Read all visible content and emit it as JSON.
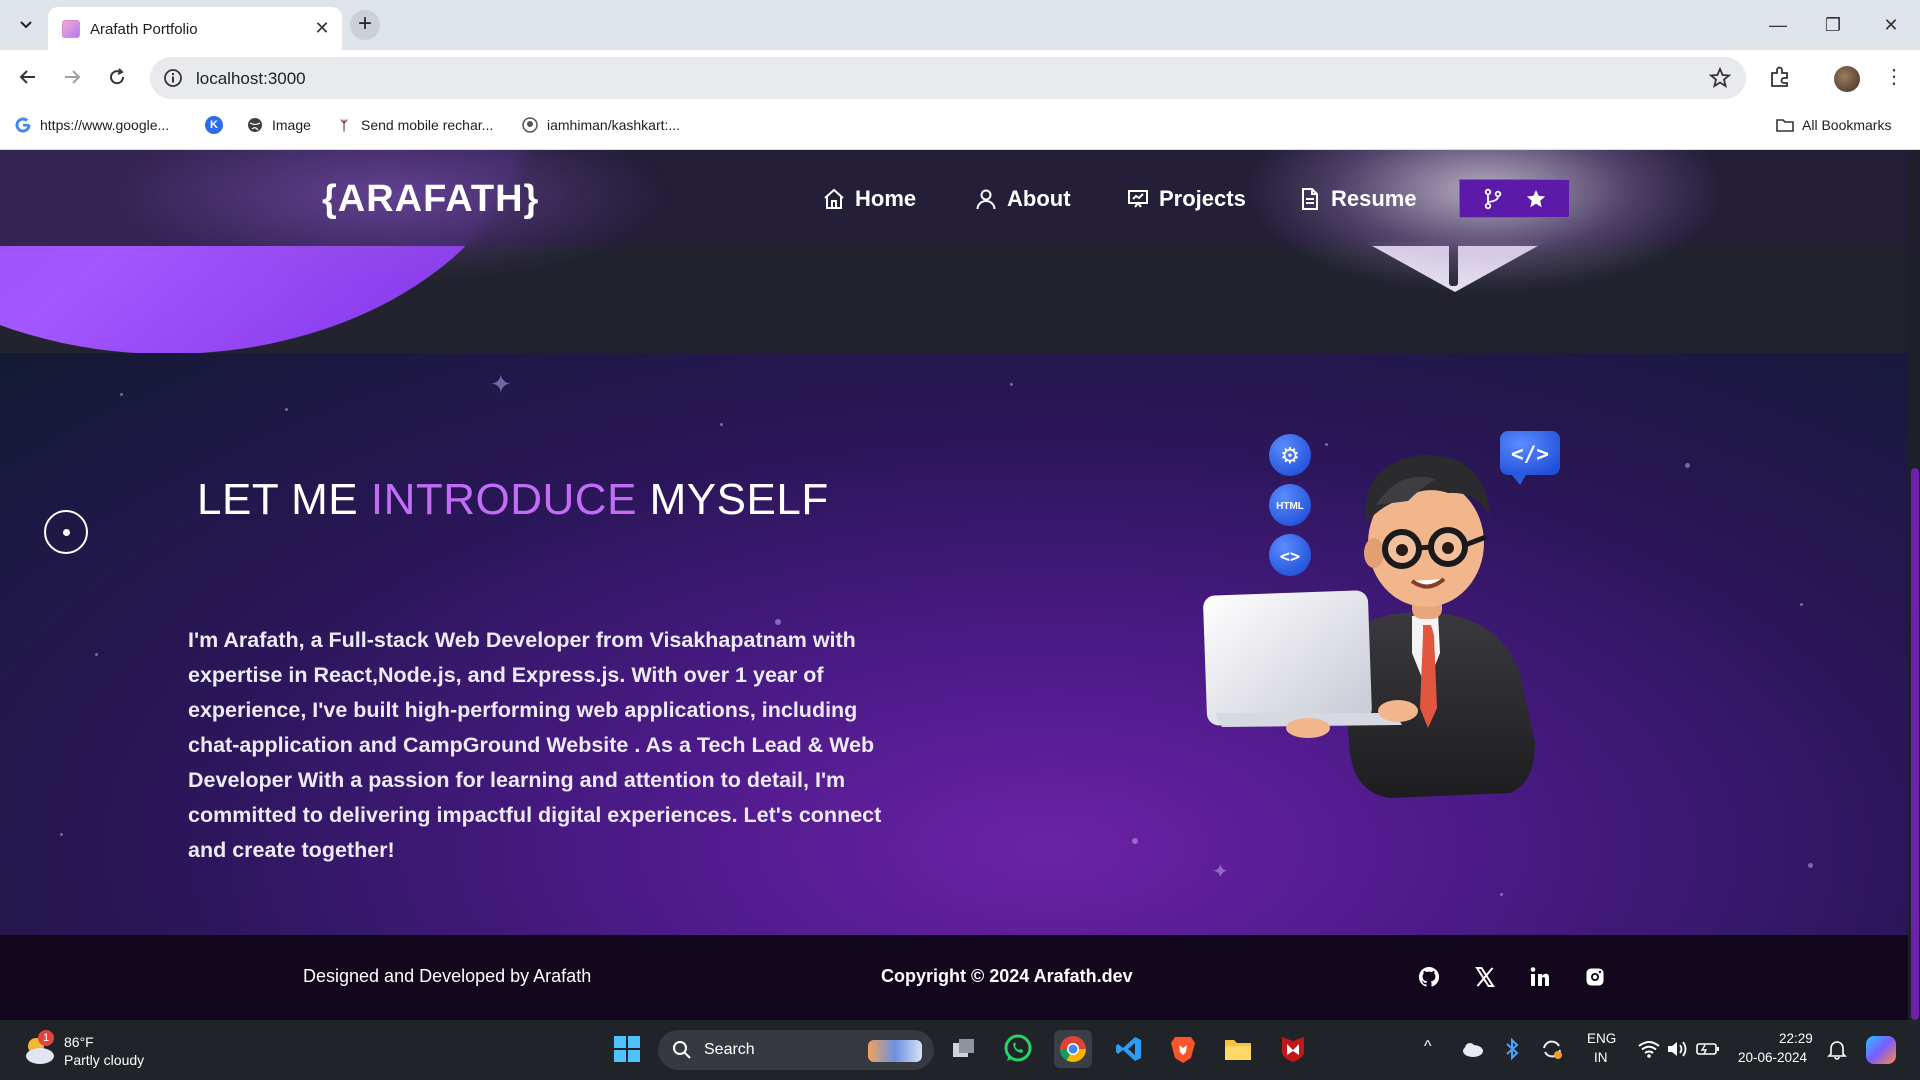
{
  "browser": {
    "tab_title": "Arafath Portfolio",
    "url": "localhost:3000",
    "bookmarks": [
      {
        "label": "https://www.google...",
        "icon": "google-icon"
      },
      {
        "label": "",
        "icon": "blue-k-icon"
      },
      {
        "label": "Image",
        "icon": "globe-icon"
      },
      {
        "label": "Send mobile rechar...",
        "icon": "paytm-icon"
      },
      {
        "label": "iamhiman/kashkart:...",
        "icon": "github-icon"
      }
    ],
    "all_bookmarks": "All Bookmarks"
  },
  "navbar": {
    "logo": "{ARAFATH}",
    "items": [
      {
        "label": "Home",
        "icon": "home-icon"
      },
      {
        "label": "About",
        "icon": "user-icon"
      },
      {
        "label": "Projects",
        "icon": "projects-icon"
      },
      {
        "label": "Resume",
        "icon": "document-icon"
      }
    ],
    "fork_icon": "git-fork-icon",
    "star_icon": "star-icon"
  },
  "about": {
    "title_part1": "LET ME ",
    "title_accent": "INTRODUCE",
    "title_part2": " MYSELF",
    "body": "I'm Arafath, a Full-stack Web Developer from Visakhapatnam with expertise in React,Node.js, and Express.js. With over 1 year of experience, I've built high-performing web applications, including chat-application and CampGround Website . As a Tech Lead & Web Developer With a passion for learning and attention to detail, I'm committed to delivering impactful digital experiences. Let's connect and create together!",
    "avatar_badges": [
      "⚙",
      "HTML",
      "<>",
      "</>"
    ]
  },
  "footer": {
    "left": "Designed and Developed by Arafath",
    "center": "Copyright © 2024 Arafath.dev",
    "social": [
      "github-icon",
      "x-icon",
      "linkedin-icon",
      "instagram-icon"
    ]
  },
  "taskbar": {
    "weather_temp": "86°F",
    "weather_desc": "Partly cloudy",
    "weather_badge": "1",
    "search": "Search",
    "lang_line1": "ENG",
    "lang_line2": "IN",
    "time": "22:29",
    "date": "20-06-2024"
  },
  "colors": {
    "accent_purple": "#c36df6",
    "nav_button": "#5b1aa8",
    "footer_bg": "#12071c"
  }
}
